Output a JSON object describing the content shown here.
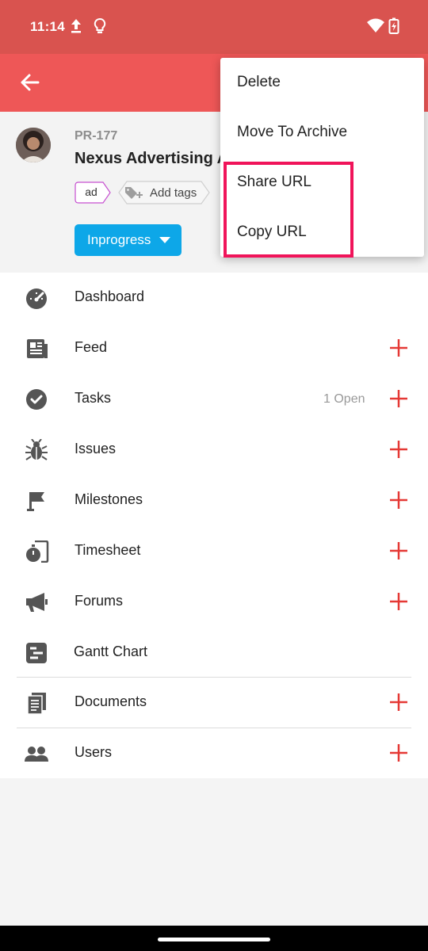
{
  "status_bar": {
    "time": "11:14",
    "icons": [
      "upload-icon",
      "lightbulb-icon",
      "wifi-icon",
      "battery-charging-icon"
    ]
  },
  "app_bar": {
    "back_icon": "arrow-left-icon",
    "color": "#ee5757"
  },
  "project": {
    "id": "PR-177",
    "title": "Nexus Advertising A",
    "tags": [
      "ad"
    ],
    "add_tags_label": "Add tags",
    "status_label": "Inprogress",
    "status_color": "#0da7e8"
  },
  "menu": {
    "items": [
      "Delete",
      "Move To Archive",
      "Share URL",
      "Copy URL"
    ],
    "highlight_color": "#f0145a"
  },
  "modules": [
    {
      "label": "Dashboard",
      "icon": "speedometer-icon",
      "has_add": false
    },
    {
      "label": "Feed",
      "icon": "newspaper-icon",
      "has_add": true
    },
    {
      "label": "Tasks",
      "icon": "check-circle-icon",
      "count": "1 Open",
      "has_add": true
    },
    {
      "label": "Issues",
      "icon": "bug-icon",
      "has_add": true
    },
    {
      "label": "Milestones",
      "icon": "flag-icon",
      "has_add": true
    },
    {
      "label": "Timesheet",
      "icon": "stopwatch-icon",
      "has_add": true
    },
    {
      "label": "Forums",
      "icon": "megaphone-icon",
      "has_add": true
    },
    {
      "label": "Gantt Chart",
      "icon": "gantt-icon",
      "has_add": false
    },
    {
      "label": "Documents",
      "icon": "documents-icon",
      "has_add": true
    },
    {
      "label": "Users",
      "icon": "users-icon",
      "has_add": true
    }
  ],
  "accent_color": "#e53935"
}
